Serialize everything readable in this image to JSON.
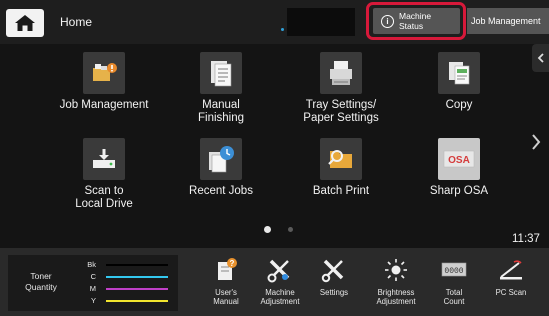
{
  "header": {
    "home_label": "Home",
    "machine_status_line1": "Machine",
    "machine_status_line2": "Status",
    "job_management_label": "Job Management"
  },
  "apps": [
    {
      "id": "job-management",
      "label": "Job Management",
      "icon": "job-management-icon"
    },
    {
      "id": "manual-finishing",
      "label": "Manual\nFinishing",
      "icon": "manual-finishing-icon"
    },
    {
      "id": "tray-settings",
      "label": "Tray Settings/\nPaper Settings",
      "icon": "tray-settings-icon"
    },
    {
      "id": "copy",
      "label": "Copy",
      "icon": "copy-icon"
    },
    {
      "id": "scan-to-local-drive",
      "label": "Scan to\nLocal Drive",
      "icon": "scan-to-local-drive-icon"
    },
    {
      "id": "recent-jobs",
      "label": "Recent Jobs",
      "icon": "recent-jobs-icon"
    },
    {
      "id": "batch-print",
      "label": "Batch Print",
      "icon": "batch-print-icon"
    },
    {
      "id": "sharp-osa",
      "label": "Sharp OSA",
      "icon": "sharp-osa-icon",
      "badge": "OSA"
    }
  ],
  "clock": "11:37",
  "toner": {
    "title_line1": "Toner",
    "title_line2": "Quantity",
    "levels": [
      {
        "name": "Bk",
        "level": 1.0,
        "color": "#000000"
      },
      {
        "name": "C",
        "level": 1.0,
        "color": "#33c8ef"
      },
      {
        "name": "M",
        "level": 1.0,
        "color": "#c040c8"
      },
      {
        "name": "Y",
        "level": 1.0,
        "color": "#f2e52e"
      }
    ]
  },
  "tools": [
    {
      "id": "users-manual",
      "line1": "User's",
      "line2": "Manual",
      "icon": "users-manual-icon"
    },
    {
      "id": "machine-adjustment",
      "line1": "Machine",
      "line2": "Adjustment",
      "icon": "machine-adjustment-icon"
    },
    {
      "id": "settings",
      "line1": "Settings",
      "line2": "",
      "icon": "settings-icon"
    },
    {
      "id": "brightness-adjustment",
      "line1": "Brightness",
      "line2": "Adjustment",
      "icon": "brightness-icon"
    },
    {
      "id": "total-count",
      "line1": "Total",
      "line2": "Count",
      "icon": "total-count-icon",
      "counter": "0000"
    },
    {
      "id": "pc-scan",
      "line1": "PC Scan",
      "line2": "",
      "icon": "pc-scan-icon"
    }
  ],
  "colors": {
    "accent_highlight": "#d7193a",
    "background": "#141414",
    "tile": "#3a3a3a"
  }
}
